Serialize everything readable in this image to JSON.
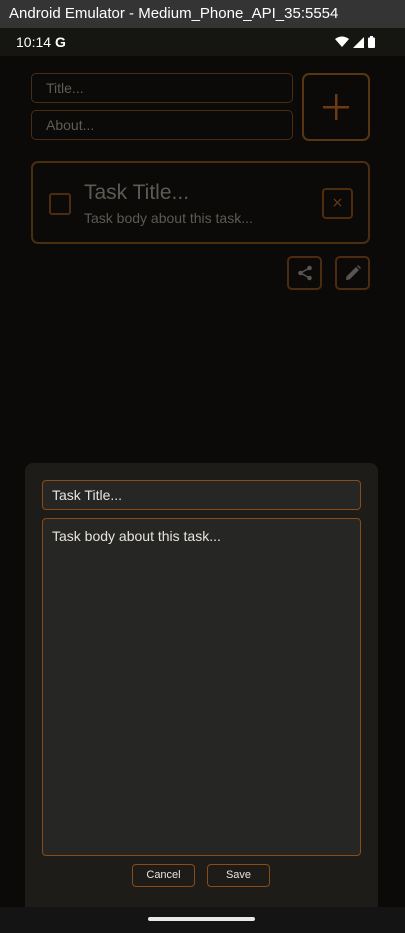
{
  "window": {
    "title": "Android Emulator - Medium_Phone_API_35:5554"
  },
  "status_bar": {
    "time": "10:14",
    "g_logo": "G"
  },
  "form": {
    "title_placeholder": "Title...",
    "about_placeholder": "About...",
    "add_icon": "+"
  },
  "task": {
    "title": "Task Title...",
    "body": "Task body about this task...",
    "delete_icon": "×"
  },
  "editor": {
    "title_value": "Task Title...",
    "body_value": "Task body about this task...",
    "cancel_label": "Cancel",
    "save_label": "Save"
  },
  "colors": {
    "accent": "#8a4b14",
    "background": "#000000",
    "sheet": "#1d1c18"
  },
  "icons": [
    "plus-icon",
    "delete-icon",
    "share-icon",
    "edit-icon",
    "wifi-icon",
    "signal-icon",
    "battery-icon"
  ]
}
